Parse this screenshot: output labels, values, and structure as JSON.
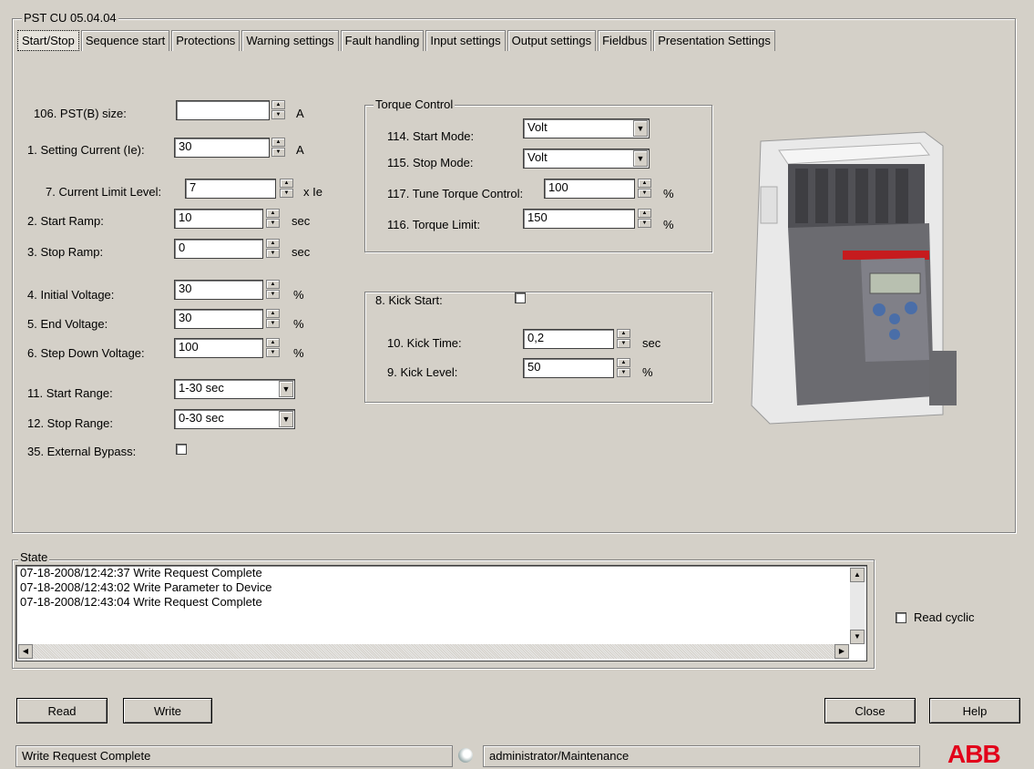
{
  "window": {
    "group_title": "PST CU 05.04.04"
  },
  "tabs": [
    {
      "label": "Start/Stop",
      "active": true
    },
    {
      "label": "Sequence start"
    },
    {
      "label": "Protections"
    },
    {
      "label": "Warning settings"
    },
    {
      "label": "Fault handling"
    },
    {
      "label": "Input settings"
    },
    {
      "label": "Output settings"
    },
    {
      "label": "Fieldbus"
    },
    {
      "label": "Presentation Settings"
    }
  ],
  "left": {
    "pst_size": {
      "label": "106. PST(B) size:",
      "value": "",
      "unit": "A"
    },
    "setting_current": {
      "label": "1. Setting Current (Ie):",
      "value": "30",
      "unit": "A"
    },
    "current_limit": {
      "label": "7. Current Limit Level:",
      "value": "7",
      "unit": "x Ie"
    },
    "start_ramp": {
      "label": "2. Start Ramp:",
      "value": "10",
      "unit": "sec"
    },
    "stop_ramp": {
      "label": "3. Stop Ramp:",
      "value": "0",
      "unit": "sec"
    },
    "initial_voltage": {
      "label": "4. Initial Voltage:",
      "value": "30",
      "unit": "%"
    },
    "end_voltage": {
      "label": "5. End Voltage:",
      "value": "30",
      "unit": "%"
    },
    "step_down_voltage": {
      "label": "6. Step Down Voltage:",
      "value": "100",
      "unit": "%"
    },
    "start_range": {
      "label": "11. Start Range:",
      "value": "1-30 sec"
    },
    "stop_range": {
      "label": "12. Stop Range:",
      "value": "0-30 sec"
    },
    "external_bypass": {
      "label": "35. External Bypass:",
      "checked": false
    }
  },
  "torque": {
    "title": "Torque Control",
    "start_mode": {
      "label": "114. Start Mode:",
      "value": "Volt"
    },
    "stop_mode": {
      "label": "115. Stop Mode:",
      "value": "Volt"
    },
    "tune": {
      "label": "117. Tune Torque Control:",
      "value": "100",
      "unit": "%"
    },
    "limit": {
      "label": "116. Torque Limit:",
      "value": "150",
      "unit": "%"
    }
  },
  "kick": {
    "label": "8. Kick Start:",
    "checked": false,
    "time": {
      "label": "10. Kick Time:",
      "value": "0,2",
      "unit": "sec"
    },
    "level": {
      "label": "9. Kick Level:",
      "value": "50",
      "unit": "%"
    }
  },
  "state": {
    "title": "State",
    "lines": [
      "07-18-2008/12:42:37 Write Request Complete",
      "07-18-2008/12:43:02 Write Parameter to Device",
      "07-18-2008/12:43:04 Write Request Complete"
    ],
    "read_cyclic": "Read cyclic"
  },
  "buttons": {
    "read": "Read",
    "write": "Write",
    "close": "Close",
    "help": "Help"
  },
  "statusbar": {
    "message": "Write Request Complete",
    "user": "administrator/Maintenance"
  },
  "brand": {
    "logo_text": "ABB",
    "color": "#e2001a"
  }
}
